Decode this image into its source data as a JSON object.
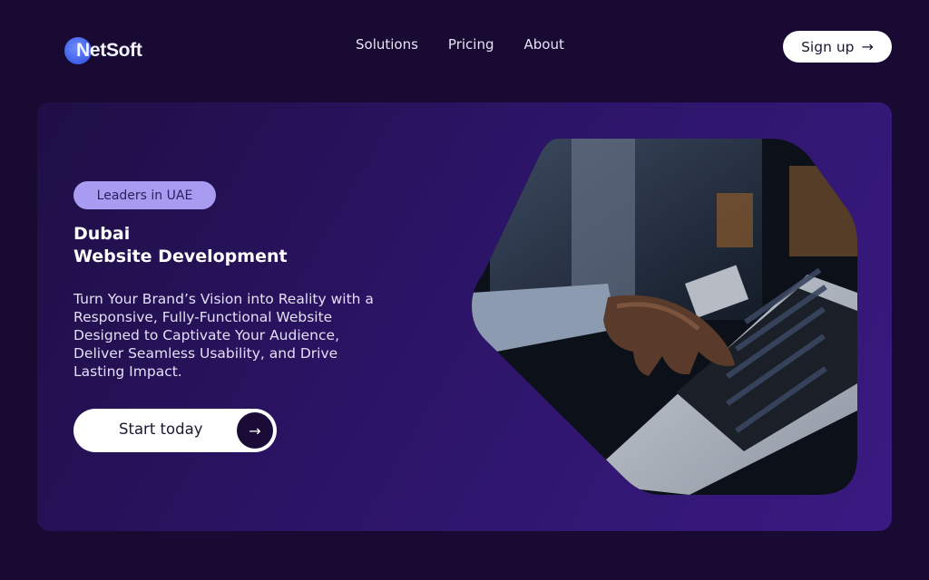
{
  "header": {
    "logo_text": "NetSoft",
    "nav": [
      "Solutions",
      "Pricing",
      "About"
    ],
    "signup_label": "Sign up",
    "signup_icon": "arrow-right-icon"
  },
  "hero": {
    "badge": "Leaders in UAE",
    "title_line1": "Dubai",
    "title_line2": "Website Development",
    "description": "Turn Your Brand’s Vision into Reality with a Responsive, Fully-Functional Website Designed to Captivate Your Audience, Deliver Seamless Usability, and Drive Lasting Impact.",
    "cta_label": "Start today",
    "cta_icon": "arrow-right-icon",
    "image_alt": "Hands typing on a laptop keyboard"
  },
  "colors": {
    "background": "#180a33",
    "hero_bg": "#2b1466",
    "badge_bg": "#a99bf2",
    "logo_blue": "#4a6cf0"
  }
}
